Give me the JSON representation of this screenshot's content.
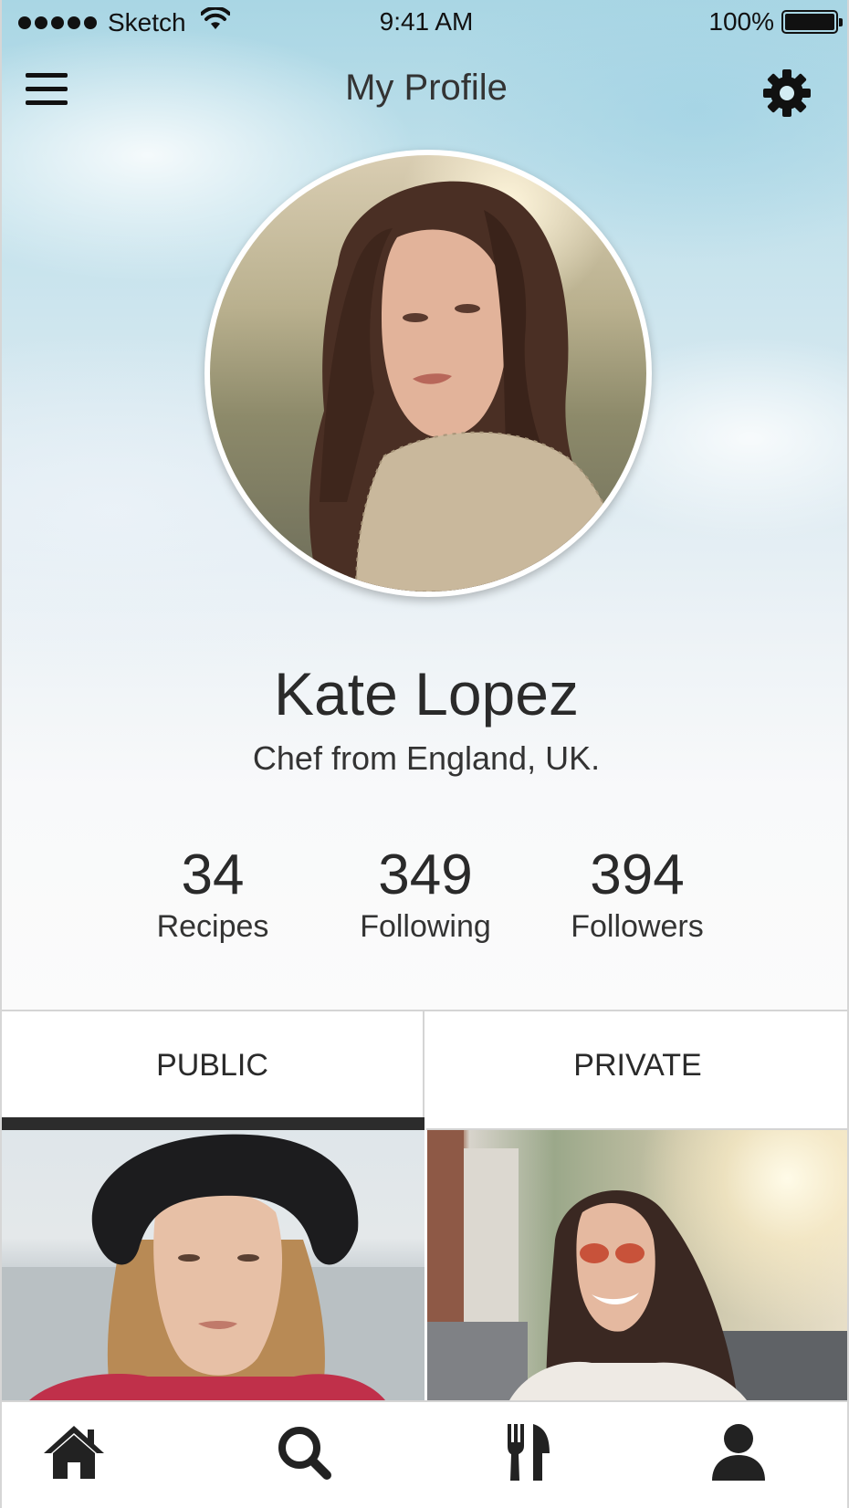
{
  "status_bar": {
    "carrier": "Sketch",
    "time": "9:41 AM",
    "battery": "100%"
  },
  "nav": {
    "title": "My Profile",
    "menu_icon": "hamburger-menu-icon",
    "settings_icon": "gear-icon"
  },
  "profile": {
    "name": "Kate Lopez",
    "bio": "Chef from England, UK."
  },
  "stats": [
    {
      "value": "34",
      "label": "Recipes"
    },
    {
      "value": "349",
      "label": "Following"
    },
    {
      "value": "394",
      "label": "Followers"
    }
  ],
  "tabs": {
    "public": "PUBLIC",
    "private": "PRIVATE",
    "active": "public"
  },
  "tab_bar": {
    "items": [
      "home-icon",
      "search-icon",
      "fork-knife-icon",
      "user-icon"
    ]
  },
  "colors": {
    "accent": "#2c2c2c",
    "text": "#2a2a2a",
    "divider": "#d4d4d4"
  }
}
